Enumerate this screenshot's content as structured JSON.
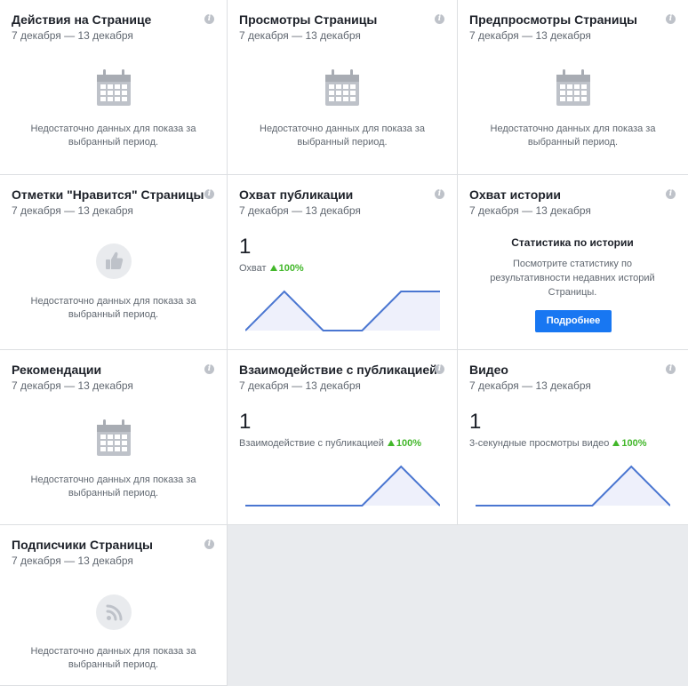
{
  "date_range": "7 декабря — 13 декабря",
  "no_data_text": "Недостаточно данных для показа за выбранный период.",
  "info_glyph": "i",
  "cards": {
    "page_actions": {
      "title": "Действия на Странице"
    },
    "page_views": {
      "title": "Просмотры Страницы"
    },
    "page_previews": {
      "title": "Предпросмотры Страницы"
    },
    "page_likes": {
      "title": "Отметки \"Нравится\" Страницы"
    },
    "post_reach": {
      "title": "Охват публикации",
      "value": "1",
      "metric_label": "Охват",
      "change": "100%",
      "chart_points": [
        0,
        1,
        0,
        0,
        1,
        1
      ]
    },
    "story_reach": {
      "title": "Охват истории",
      "heading": "Статистика по истории",
      "text": "Посмотрите статистику по результативности недавних историй Страницы.",
      "button": "Подробнее"
    },
    "recommendations": {
      "title": "Рекомендации"
    },
    "post_engagement": {
      "title": "Взаимодействие с публикацией",
      "value": "1",
      "metric_label": "Взаимодействие с публикацией",
      "change": "100%",
      "chart_points": [
        0,
        0,
        0,
        0,
        1,
        0
      ]
    },
    "video": {
      "title": "Видео",
      "value": "1",
      "metric_label": "3-секундные просмотры видео",
      "change": "100%",
      "chart_points": [
        0,
        0,
        0,
        0,
        1,
        0
      ]
    },
    "page_followers": {
      "title": "Подписчики Страницы"
    }
  },
  "icons": {
    "calendar": "calendar-icon",
    "like": "thumbs-up-icon",
    "follow": "rss-icon",
    "info": "info-icon"
  },
  "colors": {
    "accent": "#1877f2",
    "positive": "#42b72a",
    "chart_line": "#4a76d1",
    "chart_fill": "#eef0fb"
  }
}
